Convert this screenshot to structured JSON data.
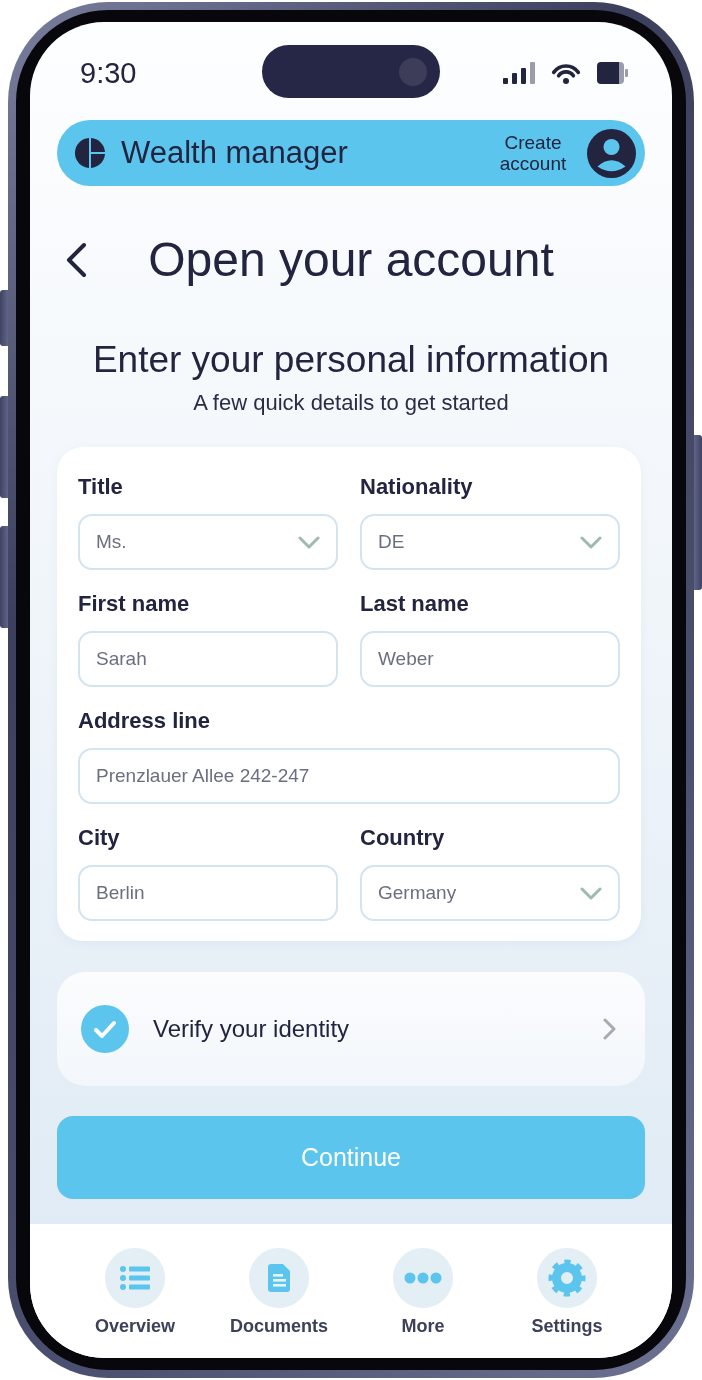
{
  "status_bar": {
    "time": "9:30"
  },
  "header": {
    "app_name": "Wealth manager",
    "action": "Create account"
  },
  "page": {
    "title": "Open your account",
    "heading": "Enter your personal information",
    "subheading": "A few quick details to get started"
  },
  "form": {
    "rows": [
      {
        "fields": [
          {
            "label": "Title",
            "kind": "select",
            "value": "Ms."
          },
          {
            "label": "Nationality",
            "kind": "select",
            "value": "DE"
          }
        ]
      },
      {
        "fields": [
          {
            "label": "First name",
            "kind": "text",
            "value": "Sarah"
          },
          {
            "label": "Last name",
            "kind": "text",
            "value": "Weber"
          }
        ]
      },
      {
        "fields": [
          {
            "label": "Address line",
            "kind": "text",
            "value": "Prenzlauer Allee 242-247"
          }
        ]
      },
      {
        "fields": [
          {
            "label": "City",
            "kind": "text",
            "value": "Berlin"
          },
          {
            "label": "Country",
            "kind": "select",
            "value": "Germany"
          }
        ]
      }
    ]
  },
  "verify": {
    "label": "Verify your identity",
    "checked": true
  },
  "continue_button": {
    "label": "Continue"
  },
  "bottom_nav": [
    {
      "label": "Overview"
    },
    {
      "label": "Documents"
    },
    {
      "label": "More"
    },
    {
      "label": "Settings"
    }
  ]
}
